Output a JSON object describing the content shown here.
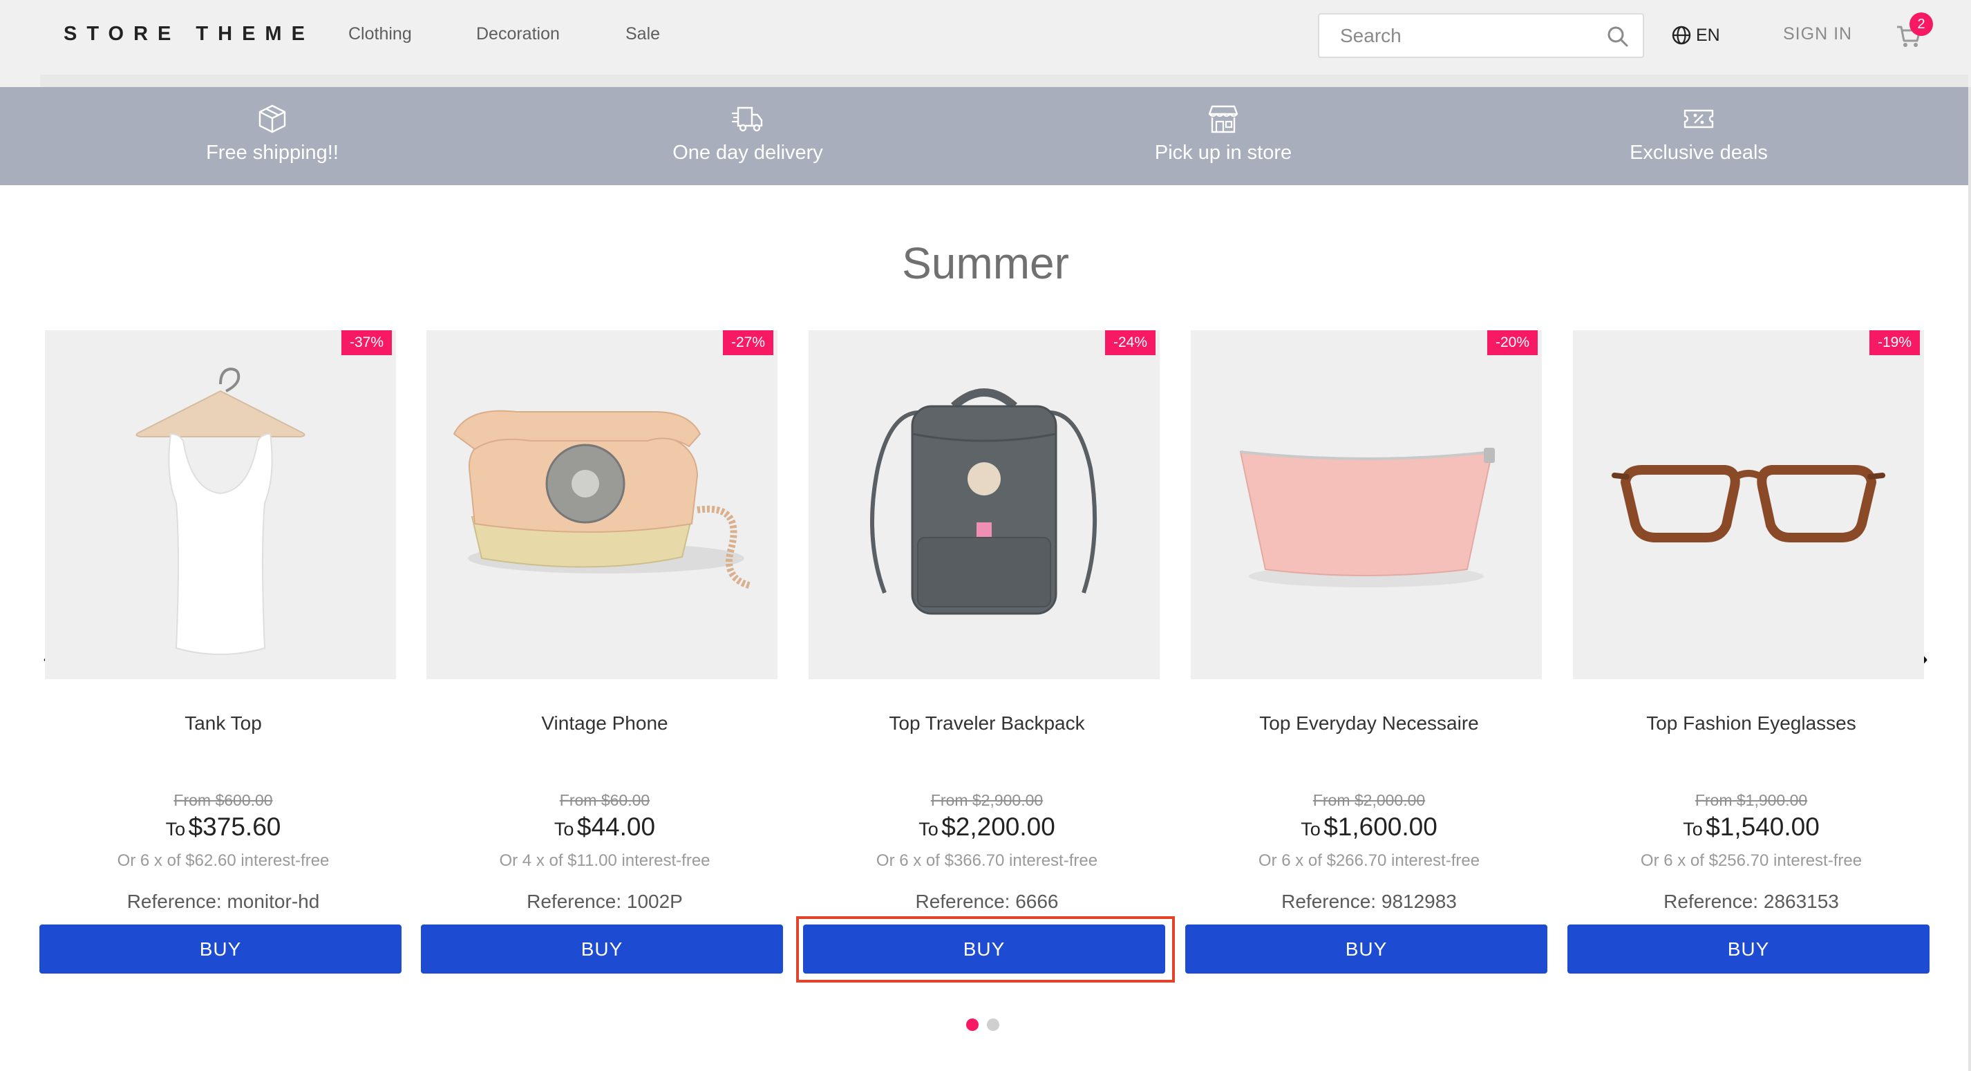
{
  "header": {
    "logo": "STORE THEME",
    "nav": [
      "Clothing",
      "Decoration",
      "Sale"
    ],
    "search_placeholder": "Search",
    "language": "EN",
    "sign_in": "SIGN IN",
    "cart_count": "2"
  },
  "benefits": [
    {
      "label": "Free shipping!!",
      "icon": "box-icon"
    },
    {
      "label": "One day delivery",
      "icon": "truck-icon"
    },
    {
      "label": "Pick up in store",
      "icon": "store-icon"
    },
    {
      "label": "Exclusive deals",
      "icon": "ticket-icon"
    }
  ],
  "shelf": {
    "title": "Summer",
    "products": [
      {
        "name": "Tank Top",
        "discount": "-37%",
        "list_price": "From $600.00",
        "to_label": "To",
        "price": "$375.60",
        "installments": "Or 6 x of $62.60 interest-free",
        "reference": "Reference: monitor-hd",
        "buy": "BUY"
      },
      {
        "name": "Vintage Phone",
        "discount": "-27%",
        "list_price": "From $60.00",
        "to_label": "To",
        "price": "$44.00",
        "installments": "Or 4 x of $11.00 interest-free",
        "reference": "Reference: 1002P",
        "buy": "BUY"
      },
      {
        "name": "Top Traveler Backpack",
        "discount": "-24%",
        "list_price": "From $2,900.00",
        "to_label": "To",
        "price": "$2,200.00",
        "installments": "Or 6 x of $366.70 interest-free",
        "reference": "Reference: 6666",
        "buy": "BUY"
      },
      {
        "name": "Top Everyday Necessaire",
        "discount": "-20%",
        "list_price": "From $2,000.00",
        "to_label": "To",
        "price": "$1,600.00",
        "installments": "Or 6 x of $266.70 interest-free",
        "reference": "Reference: 9812983",
        "buy": "BUY"
      },
      {
        "name": "Top Fashion Eyeglasses",
        "discount": "-19%",
        "list_price": "From $1,900.00",
        "to_label": "To",
        "price": "$1,540.00",
        "installments": "Or 6 x of $256.70 interest-free",
        "reference": "Reference: 2863153",
        "buy": "BUY"
      }
    ],
    "pagination": {
      "pages": 2,
      "active": 1
    }
  },
  "colors": {
    "header_bg": "#f0f0f0",
    "benefits_bg": "#a8aebb",
    "buy_button": "#1d4bd2",
    "discount_badge": "#f71963",
    "highlight_outline": "#e2432b"
  }
}
